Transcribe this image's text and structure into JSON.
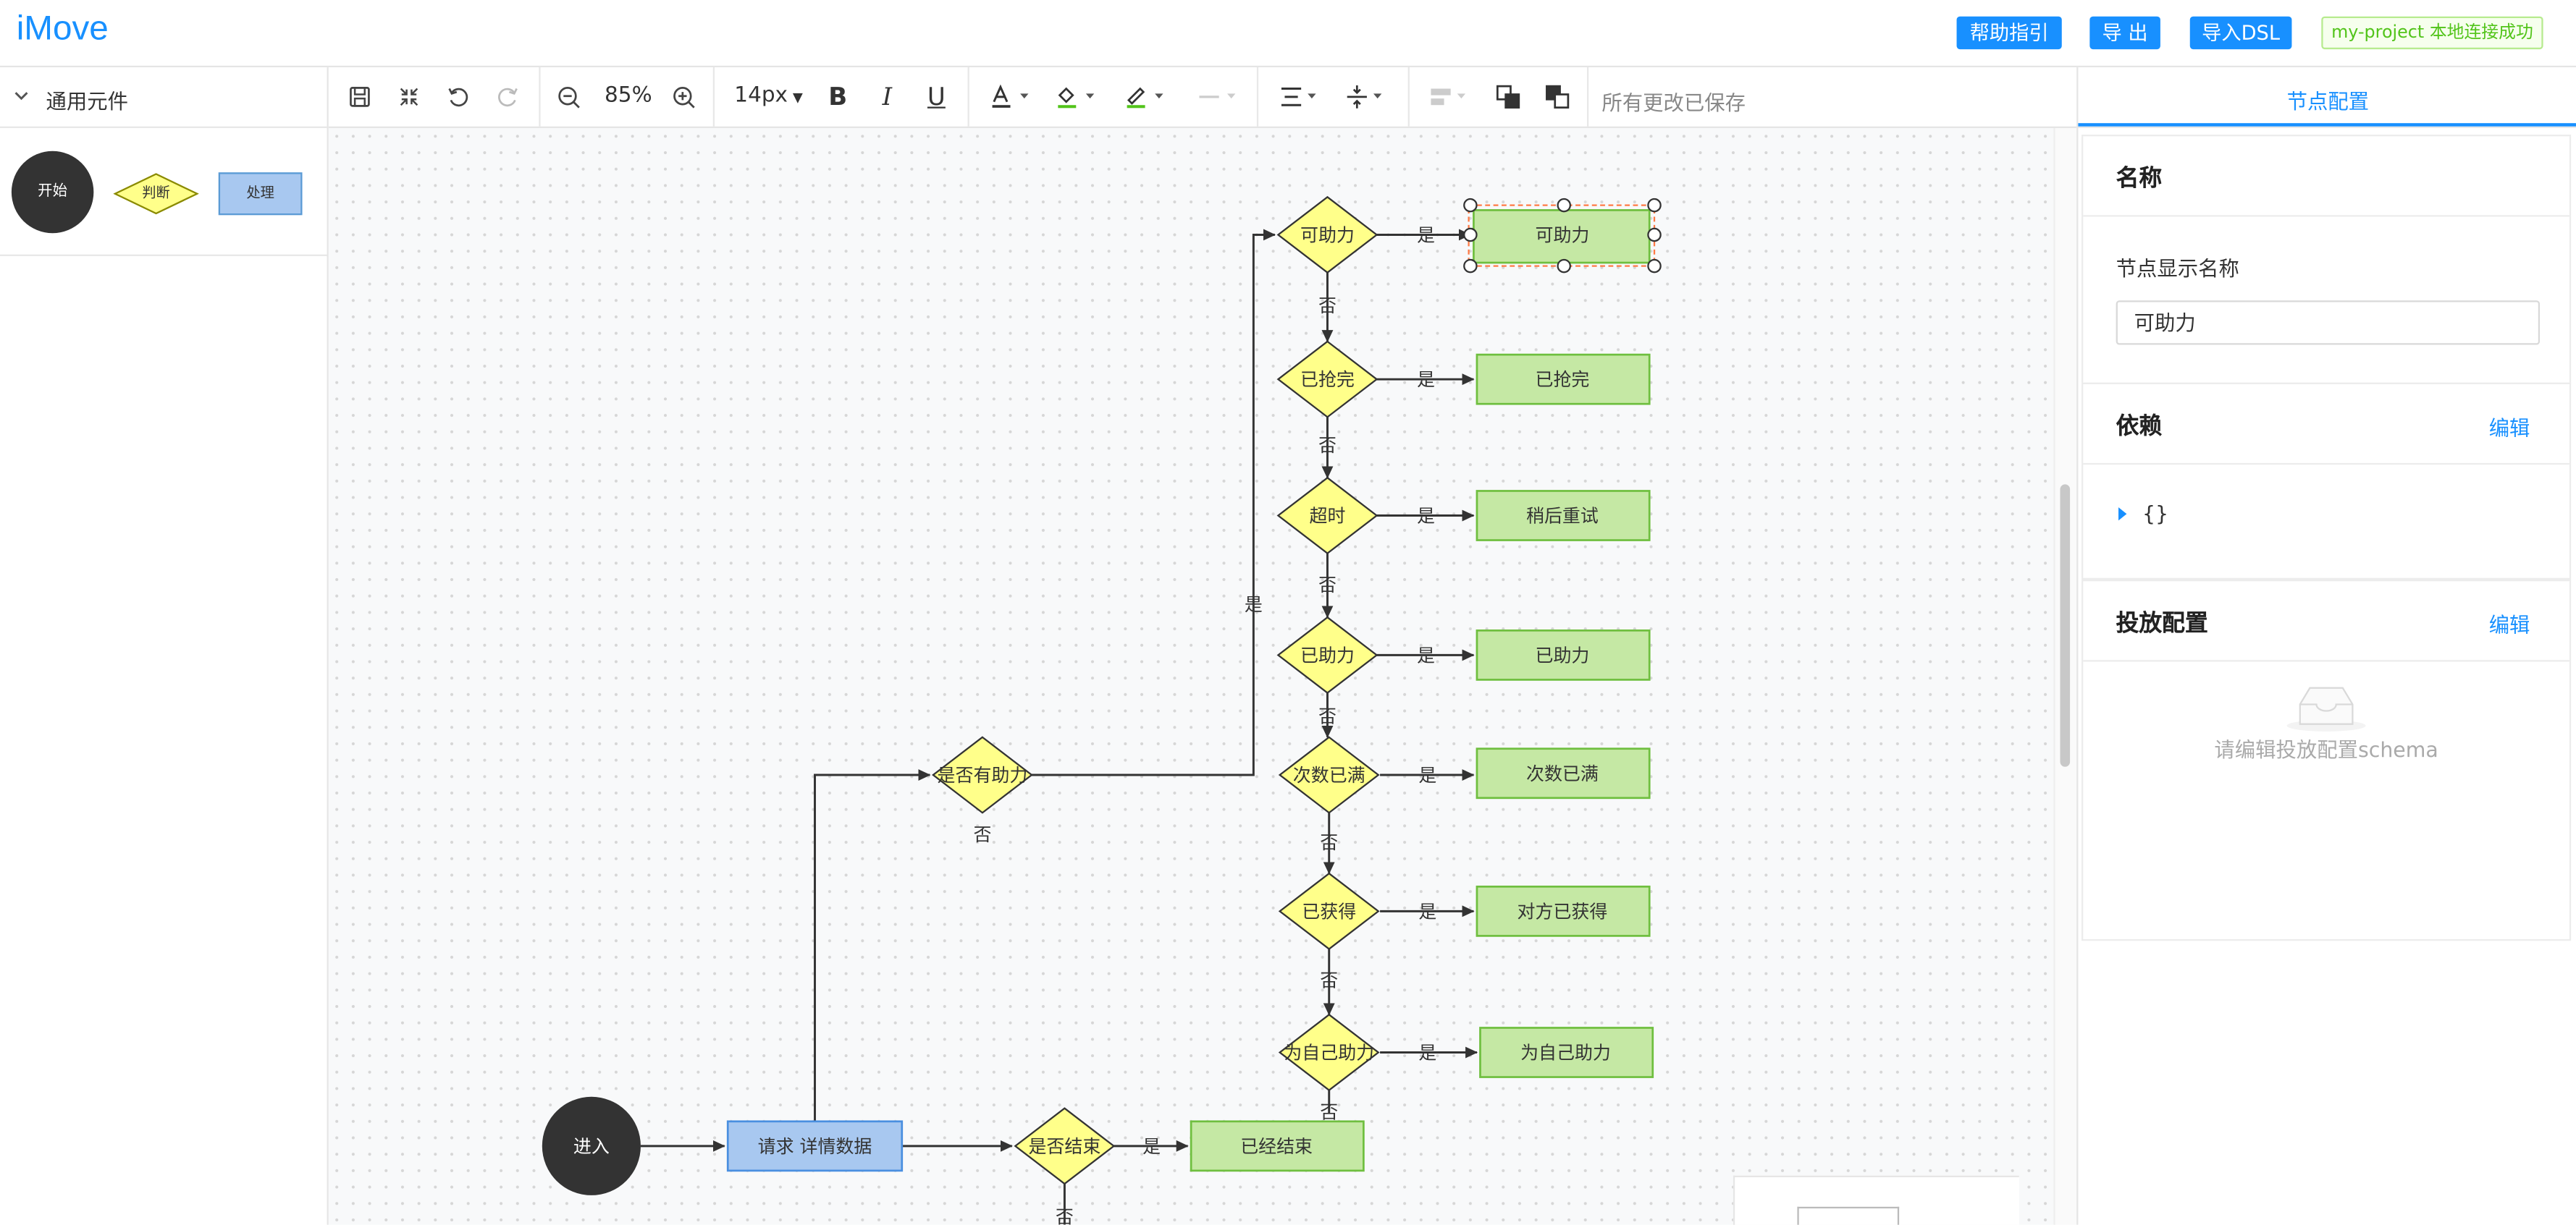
{
  "app": {
    "logo": "iMove"
  },
  "header": {
    "help_label": "帮助指引",
    "export_label": "导 出",
    "import_label": "导入DSL",
    "status_text": "my-project 本地连接成功"
  },
  "left_panel": {
    "title": "通用元件",
    "shapes": {
      "start": "开始",
      "judge": "判断",
      "process": "处理"
    }
  },
  "toolbar": {
    "zoom": "85%",
    "font_size": "14px",
    "bold": "B",
    "italic": "I",
    "underline": "U",
    "save_status": "所有更改已保存"
  },
  "flow": {
    "nodes": {
      "enter": "进入",
      "request": "请求 详情数据",
      "is_ended": "是否结束",
      "ended": "已经结束",
      "has_help": "是否有助力",
      "can_help_q": "可助力",
      "can_help": "可助力",
      "taken_q": "已抢完",
      "taken": "已抢完",
      "timeout_q": "超时",
      "retry": "稍后重试",
      "helped_q": "已助力",
      "helped": "已助力",
      "full_q": "次数已满",
      "full": "次数已满",
      "got_q": "已获得",
      "got": "对方已获得",
      "self_q": "为自己助力",
      "self": "为自己助力"
    },
    "labels": {
      "yes": "是",
      "no": "否"
    }
  },
  "right_panel": {
    "tab": "节点配置",
    "name_section": {
      "title": "名称",
      "field_label": "节点显示名称",
      "field_value": "可助力"
    },
    "dependency_section": {
      "title": "依赖",
      "edit_label": "编辑",
      "value": "{}"
    },
    "placement_section": {
      "title": "投放配置",
      "edit_label": "编辑",
      "empty_text": "请编辑投放配置schema"
    }
  },
  "colors": {
    "accent": "#1890ff",
    "diamond_fill": "#ffff8a",
    "process_fill": "#c5e8a4",
    "request_fill": "#a8c8f0",
    "start_fill": "#333333"
  }
}
